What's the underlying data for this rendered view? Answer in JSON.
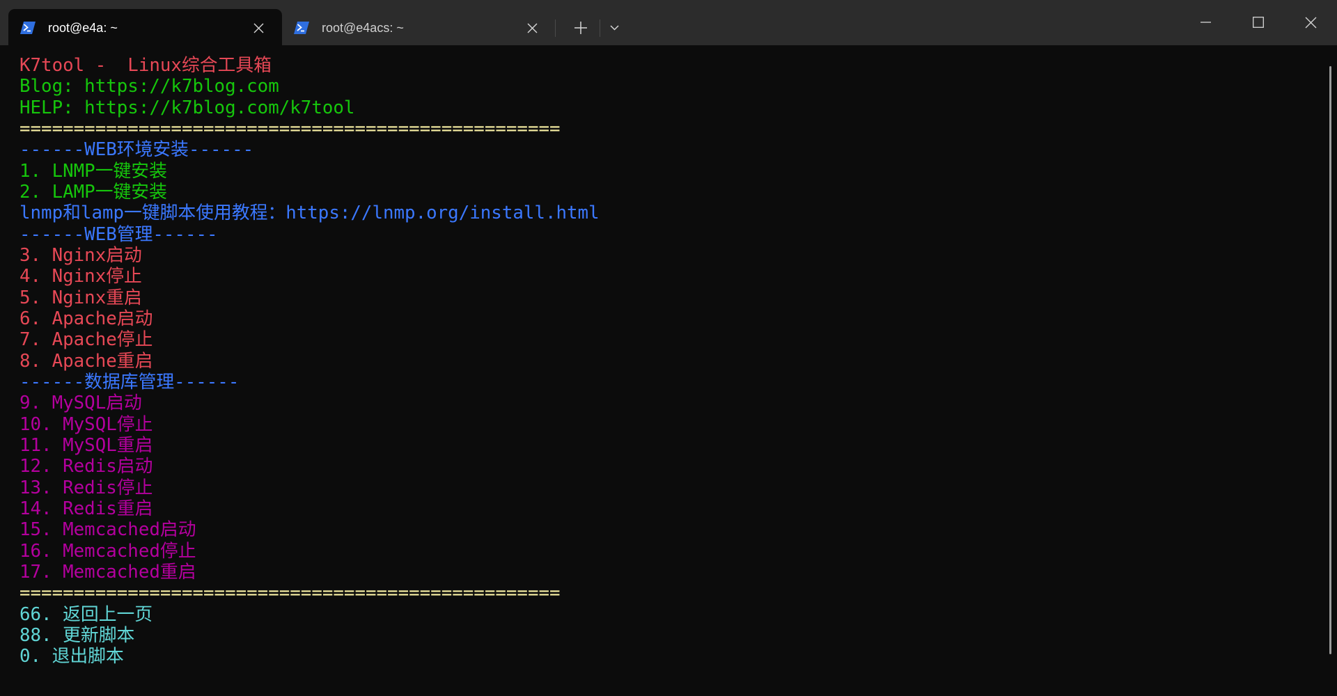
{
  "window": {
    "tab_row": {
      "tabs": [
        {
          "title": "root@e4a: ~",
          "icon": "powershell-icon",
          "active": true,
          "close_icon": "close-icon"
        },
        {
          "title": "root@e4acs: ~",
          "icon": "powershell-icon",
          "active": false,
          "close_icon": "close-icon"
        }
      ],
      "new_tab_icon": "plus-icon",
      "dropdown_icon": "chevron-down-icon"
    },
    "caption_buttons": {
      "minimize_icon": "minimize-icon",
      "maximize_icon": "maximize-icon",
      "close_icon": "close-icon"
    }
  },
  "colors": {
    "titlebar_bg": "#2c2c2c",
    "terminal_bg": "#0c0c0c",
    "active_tab_bg": "#0c0c0c",
    "tab_text": "#ffffff",
    "inactive_tab_text": "#d0d0d0",
    "icon_stroke": "#d6d6d6",
    "scrollbar": "#9b9b9b",
    "powershell_blue": "#2f6fe0"
  },
  "terminal": {
    "lines": [
      {
        "text": "K7tool -  Linux综合工具箱",
        "color": "#e74856"
      },
      {
        "text": "Blog: https://k7blog.com",
        "color": "#16c60c"
      },
      {
        "text": "HELP: https://k7blog.com/k7tool",
        "color": "#16c60c"
      },
      {
        "text": "==================================================",
        "color": "#f9f1a5"
      },
      {
        "text": "------WEB环境安装------",
        "color": "#3b78ff"
      },
      {
        "text": "1. LNMP一键安装",
        "color": "#16c60c"
      },
      {
        "text": "2. LAMP一键安装",
        "color": "#16c60c"
      },
      {
        "text": "lnmp和lamp一键脚本使用教程：https://lnmp.org/install.html",
        "color": "#3b78ff"
      },
      {
        "text": "------WEB管理------",
        "color": "#3b78ff"
      },
      {
        "text": "3. Nginx启动",
        "color": "#e74856"
      },
      {
        "text": "4. Nginx停止",
        "color": "#e74856"
      },
      {
        "text": "5. Nginx重启",
        "color": "#e74856"
      },
      {
        "text": "6. Apache启动",
        "color": "#e74856"
      },
      {
        "text": "7. Apache停止",
        "color": "#e74856"
      },
      {
        "text": "8. Apache重启",
        "color": "#e74856"
      },
      {
        "text": "------数据库管理------",
        "color": "#3b78ff"
      },
      {
        "text": "9. MySQL启动",
        "color": "#b4009e"
      },
      {
        "text": "10. MySQL停止",
        "color": "#b4009e"
      },
      {
        "text": "11. MySQL重启",
        "color": "#b4009e"
      },
      {
        "text": "12. Redis启动",
        "color": "#b4009e"
      },
      {
        "text": "13. Redis停止",
        "color": "#b4009e"
      },
      {
        "text": "14. Redis重启",
        "color": "#b4009e"
      },
      {
        "text": "15. Memcached启动",
        "color": "#b4009e"
      },
      {
        "text": "16. Memcached停止",
        "color": "#b4009e"
      },
      {
        "text": "17. Memcached重启",
        "color": "#b4009e"
      },
      {
        "text": "==================================================",
        "color": "#f9f1a5"
      },
      {
        "text": "66. 返回上一页",
        "color": "#61d6d6"
      },
      {
        "text": "88. 更新脚本",
        "color": "#61d6d6"
      },
      {
        "text": "0. 退出脚本",
        "color": "#61d6d6"
      }
    ]
  }
}
